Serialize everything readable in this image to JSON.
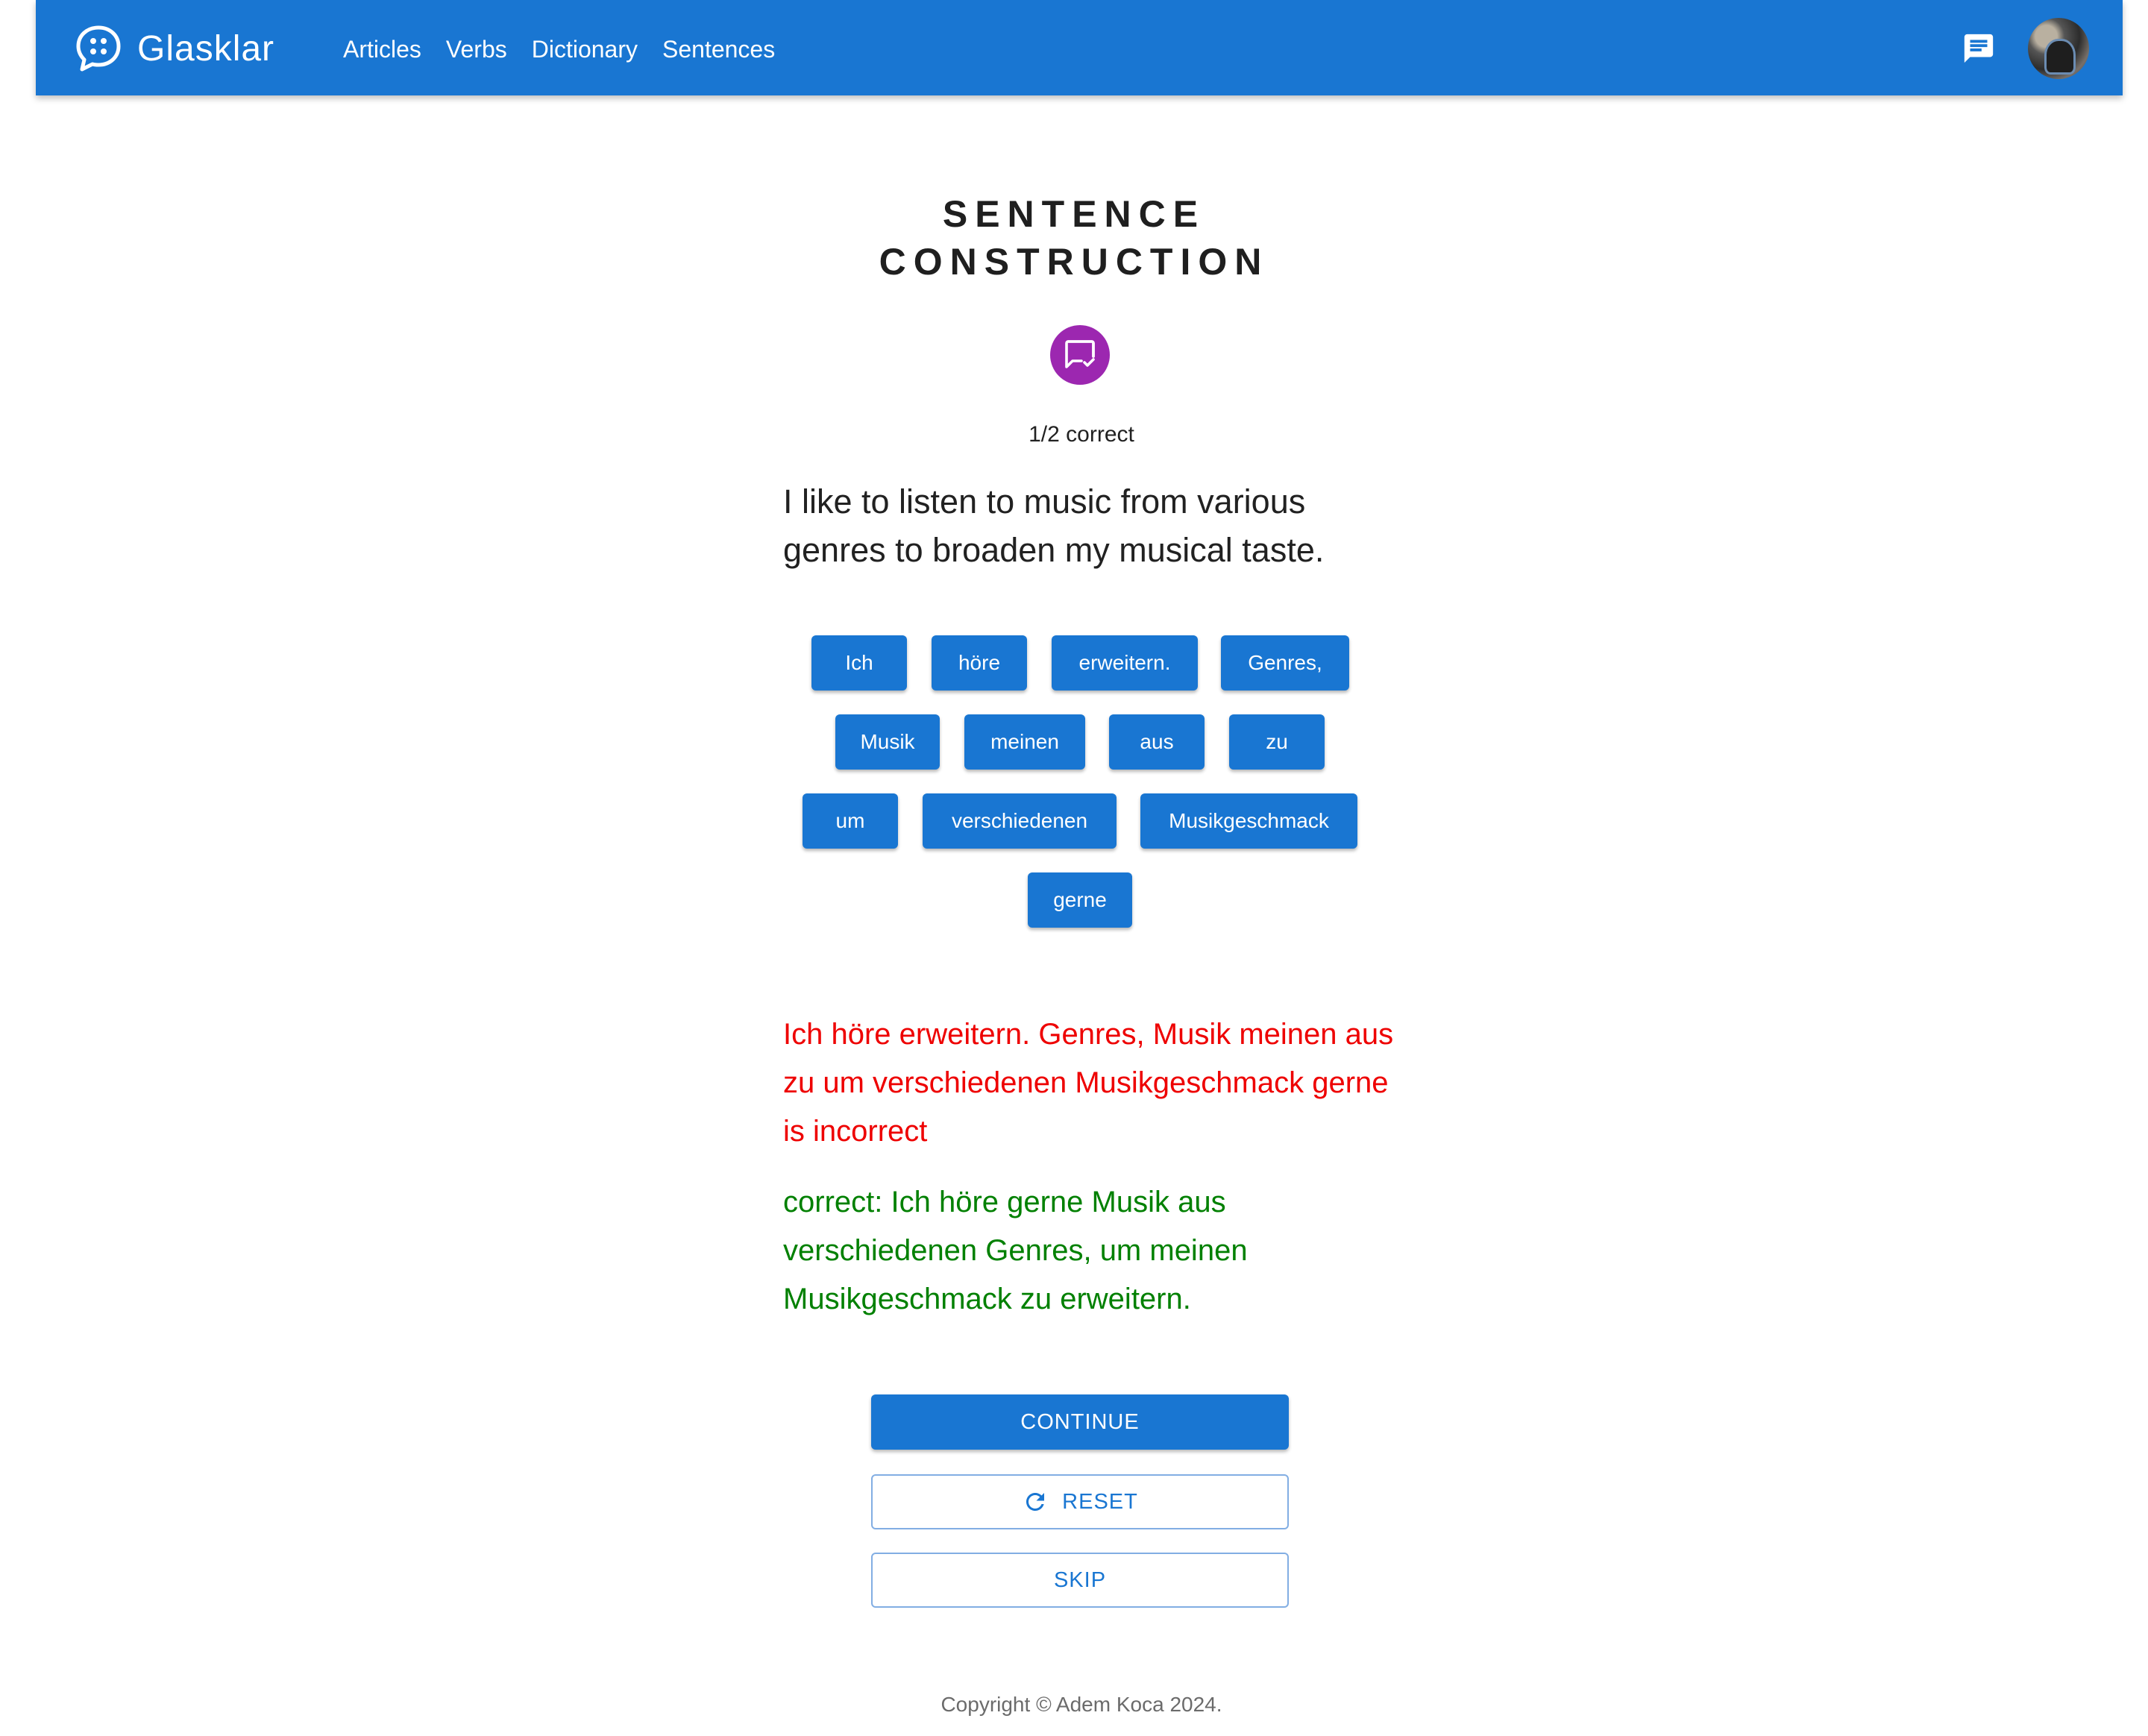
{
  "brand": {
    "name": "Glasklar",
    "icon": "chat-bubble-dots-icon"
  },
  "nav": {
    "items": [
      "Articles",
      "Verbs",
      "Dictionary",
      "Sentences"
    ]
  },
  "header": {
    "chat_icon": "message-icon",
    "avatar": "user-avatar"
  },
  "page": {
    "title_line1": "SENTENCE",
    "title_line2": "CONSTRUCTION",
    "badge_icon": "chat-check-icon",
    "score": "1/2 correct",
    "prompt": "I like to listen to music from various genres to broaden my musical taste."
  },
  "words": [
    "Ich",
    "höre",
    "erweitern.",
    "Genres,",
    "Musik",
    "meinen",
    "aus",
    "zu",
    "um",
    "verschiedenen",
    "Musikgeschmack",
    "gerne"
  ],
  "feedback": {
    "wrong": "Ich höre erweitern. Genres, Musik meinen aus zu um verschiedenen Musikgeschmack gerne is incorrect",
    "correct": "correct: Ich höre gerne Musik aus verschiedenen Genres, um meinen Musikgeschmack zu erweitern."
  },
  "actions": {
    "continue": "CONTINUE",
    "reset": "RESET",
    "skip": "SKIP",
    "reset_icon": "refresh-icon"
  },
  "footer": {
    "copyright": "Copyright © Adem Koca 2024."
  },
  "colors": {
    "primary": "#1976d2",
    "badge": "#9c27b0",
    "error": "#ee0000",
    "success": "#008000"
  }
}
